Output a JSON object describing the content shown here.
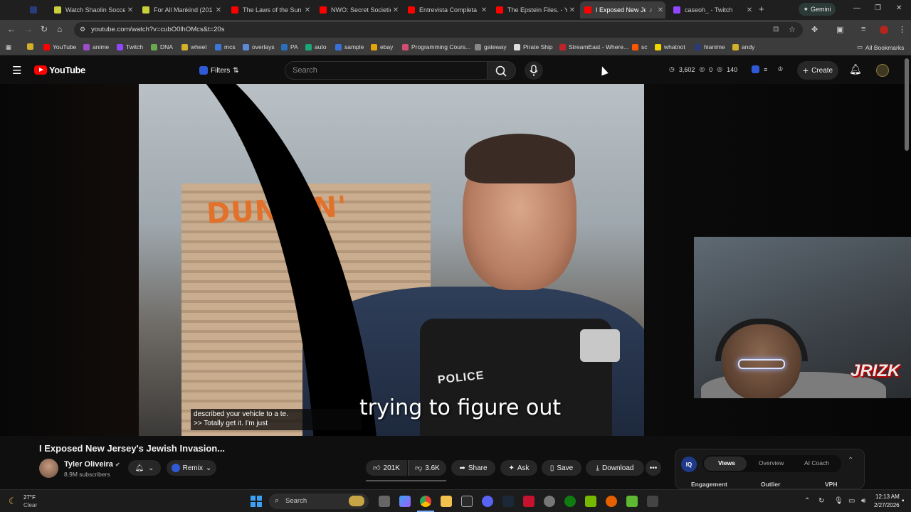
{
  "browser": {
    "tabs": [
      {
        "title": "",
        "favicon_color": "#2a3b7a"
      },
      {
        "title": "Watch Shaolin Socce",
        "favicon_color": "#c9d13a"
      },
      {
        "title": "For All Mankind (201",
        "favicon_color": "#c9d13a"
      },
      {
        "title": "The Laws of the Sun",
        "favicon_color": "#ff0000"
      },
      {
        "title": "NWO: Secret Societie",
        "favicon_color": "#ff0000"
      },
      {
        "title": "Entrevista Completa",
        "favicon_color": "#ff0000"
      },
      {
        "title": "The Epstein Files. - Yo",
        "favicon_color": "#ff0000"
      },
      {
        "title": "I Exposed New Je",
        "favicon_color": "#ff0000",
        "active": true
      },
      {
        "title": "caseoh_ - Twitch",
        "favicon_color": "#9146ff"
      }
    ],
    "new_tab": "+",
    "gemini_label": "Gemini",
    "url": "youtube.com/watch?v=cubO0lhOMcs&t=20s",
    "bookmarks": [
      {
        "label": "YouTube",
        "color": "#ff0000"
      },
      {
        "label": "anime",
        "color": "#9b4dca"
      },
      {
        "label": "Twitch",
        "color": "#9146ff"
      },
      {
        "label": "DNA",
        "color": "#6aa84f"
      },
      {
        "label": "wheel",
        "color": "#d4b02a"
      },
      {
        "label": "mcs",
        "color": "#3a78d8"
      },
      {
        "label": "overlays",
        "color": "#5b8bd8"
      },
      {
        "label": "PA",
        "color": "#2c6fbf"
      },
      {
        "label": "auto",
        "color": "#19a974"
      },
      {
        "label": "sample",
        "color": "#3b6fd8"
      },
      {
        "label": "ebay",
        "color": "#e5a50a"
      },
      {
        "label": "Programming Cours...",
        "color": "#d14d72"
      },
      {
        "label": "gateway",
        "color": "#888888"
      },
      {
        "label": "Pirate Ship",
        "color": "#dddddd"
      },
      {
        "label": "StreamEast - Where...",
        "color": "#c0242a"
      },
      {
        "label": "sc",
        "color": "#ff5500"
      },
      {
        "label": "whatnot",
        "color": "#f2d600"
      },
      {
        "label": "hianime",
        "color": "#2a3b7a"
      },
      {
        "label": "andy",
        "color": "#d4b02a"
      }
    ],
    "all_bookmarks": "All Bookmarks"
  },
  "youtube": {
    "logo_text": "YouTube",
    "filters_label": "Filters",
    "search_placeholder": "Search",
    "stats": {
      "views": "3,602",
      "zero": "0",
      "count": "140"
    },
    "create_label": "Create",
    "video": {
      "caption_line1": "described your vehicle to a te.",
      "caption_line2": ">> Totally get it. I'm just",
      "big_caption": "trying to figure out",
      "frame_text_sign": "DUNKIN'",
      "frame_text_vest": "POLICE",
      "webcam_logo": "JRIZK"
    },
    "title": "I Exposed New Jersey's Jewish Invasion...",
    "channel": {
      "name": "Tyler Oliveira",
      "subscribers": "8.9M subscribers"
    },
    "remix_label": "Remix",
    "actions": {
      "likes": "201K",
      "dislikes": "3.6K",
      "share": "Share",
      "ask": "Ask",
      "save": "Save",
      "download": "Download",
      "more": "•••"
    },
    "iq_panel": {
      "logo": "IQ",
      "tabs": [
        "Views",
        "Overview",
        "AI Coach"
      ],
      "columns": [
        "Engagement",
        "Outlier",
        "VPH"
      ]
    }
  },
  "taskbar": {
    "weather_temp": "27°F",
    "weather_cond": "Clear",
    "search_label": "Search",
    "time": "12:13 AM",
    "date": "2/27/2026"
  }
}
